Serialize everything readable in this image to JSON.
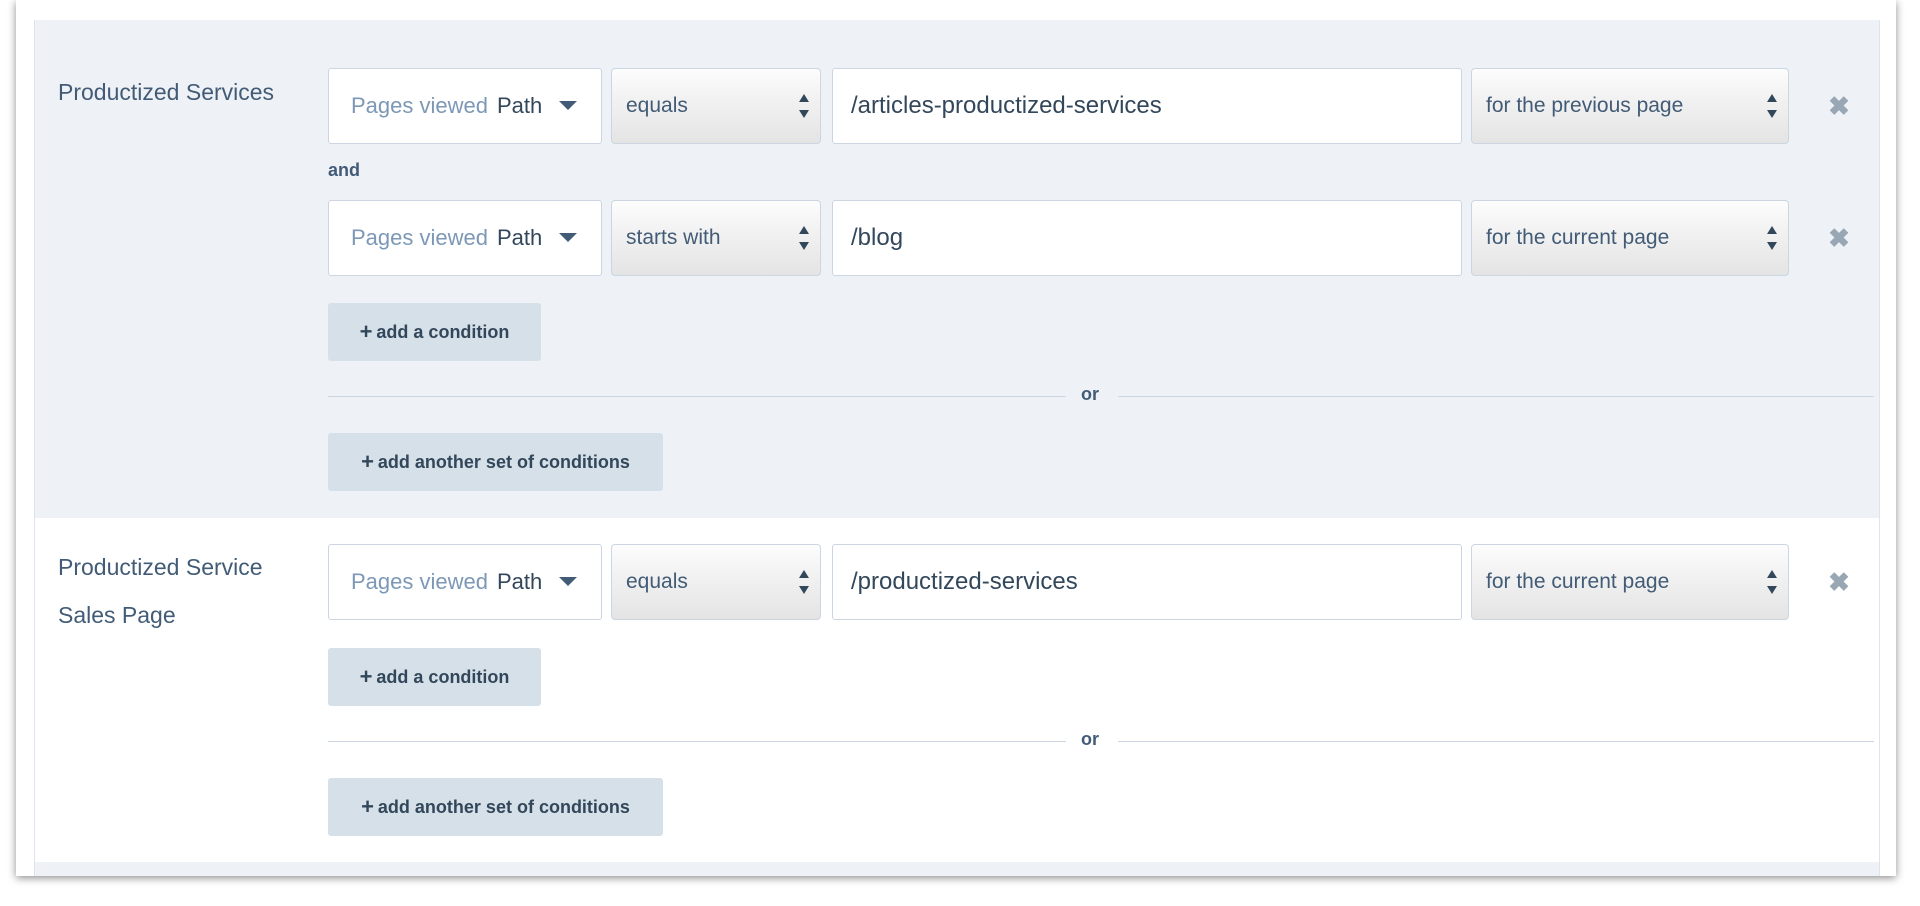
{
  "segments": [
    {
      "name": "Productized Services",
      "conditions": [
        {
          "property_placeholder": "Pages viewed",
          "property_value": "Path",
          "operator": "equals",
          "value": "/articles-productized-services",
          "scope": "for the previous page"
        },
        {
          "property_placeholder": "Pages viewed",
          "property_value": "Path",
          "operator": "starts with",
          "value": "/blog",
          "scope": "for the current page"
        }
      ]
    },
    {
      "name_lines": [
        "Productized Service",
        "Sales Page"
      ],
      "conditions": [
        {
          "property_placeholder": "Pages viewed",
          "property_value": "Path",
          "operator": "equals",
          "value": "/productized-services",
          "scope": "for the current page"
        }
      ]
    }
  ],
  "labels": {
    "and": "and",
    "or": "or",
    "add_condition_plus": "+",
    "add_condition": "add a condition",
    "add_set_plus": "+",
    "add_set": "add another set of conditions",
    "remove_glyph": "✖"
  },
  "colors": {
    "panel_shaded": "#eef2f7",
    "button_bg": "#d6e0e9",
    "text": "#33475b"
  }
}
